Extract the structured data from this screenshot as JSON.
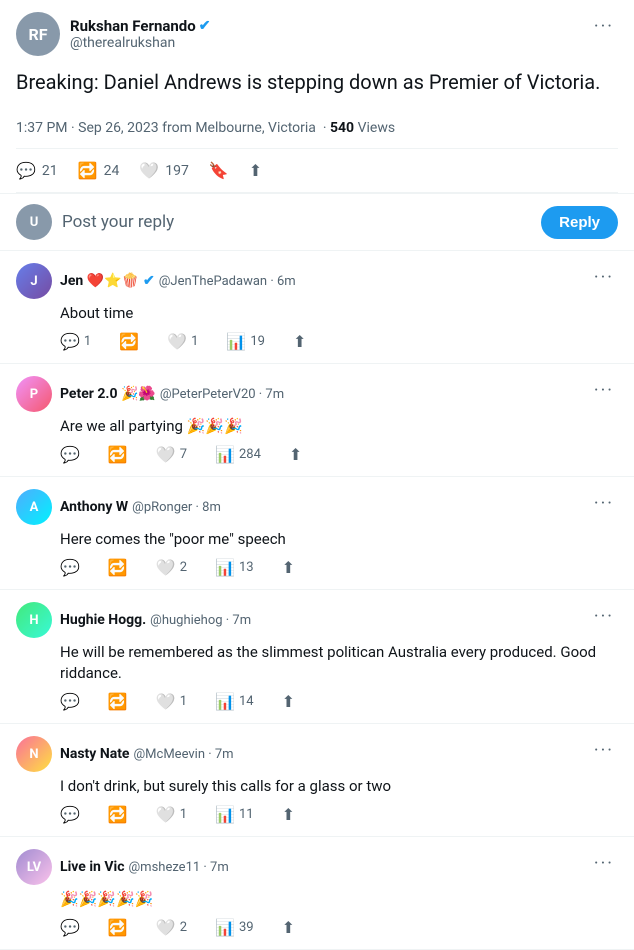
{
  "main_tweet": {
    "author_name": "Rukshan Fernando",
    "author_handle": "@therealrukshan",
    "verified": true,
    "content": "Breaking: Daniel Andrews is stepping down as Premier of Victoria.",
    "timestamp": "1:37 PM · Sep 26, 2023 from Melbourne, Victoria",
    "views": "540",
    "views_label": "Views",
    "stats": {
      "comments": "21",
      "retweets": "24",
      "likes": "197"
    }
  },
  "reply_box": {
    "placeholder": "Post your reply",
    "button_label": "Reply"
  },
  "more_label": "···",
  "replies": [
    {
      "id": 1,
      "name": "Jen ❤️⭐🍿",
      "verified": true,
      "handle": "@JenThePadawan",
      "time": "6m",
      "content": "About time",
      "comments": "1",
      "retweets": "",
      "likes": "1",
      "views": "19",
      "avatar_initials": "J",
      "avatar_class": "av1"
    },
    {
      "id": 2,
      "name": "Peter 2.0 🎉🌺",
      "verified": false,
      "handle": "@PeterPeterV20",
      "time": "7m",
      "content": "Are we all partying 🎉🎉🎉",
      "comments": "",
      "retweets": "",
      "likes": "7",
      "views": "284",
      "avatar_initials": "P",
      "avatar_class": "av2"
    },
    {
      "id": 3,
      "name": "Anthony W",
      "verified": false,
      "handle": "@pRonger",
      "time": "8m",
      "content": "Here comes the \"poor me\" speech",
      "comments": "",
      "retweets": "",
      "likes": "2",
      "views": "13",
      "avatar_initials": "A",
      "avatar_class": "av3"
    },
    {
      "id": 4,
      "name": "Hughie Hogg.",
      "verified": false,
      "handle": "@hughiehog",
      "time": "7m",
      "content": "He will be remembered as the slimmest politican Australia every produced. Good riddance.",
      "comments": "",
      "retweets": "",
      "likes": "1",
      "views": "14",
      "avatar_initials": "H",
      "avatar_class": "av4"
    },
    {
      "id": 5,
      "name": "Nasty Nate",
      "verified": false,
      "handle": "@McMeevin",
      "time": "7m",
      "content": "I don't drink, but surely this calls for a glass or two",
      "comments": "",
      "retweets": "",
      "likes": "1",
      "views": "11",
      "avatar_initials": "N",
      "avatar_class": "av5"
    },
    {
      "id": 6,
      "name": "Live in Vic",
      "verified": false,
      "handle": "@msheze11",
      "time": "7m",
      "content": "🎉🎉🎉🎉🎉",
      "comments": "",
      "retweets": "",
      "likes": "2",
      "views": "39",
      "avatar_initials": "LV",
      "avatar_class": "av6"
    }
  ]
}
